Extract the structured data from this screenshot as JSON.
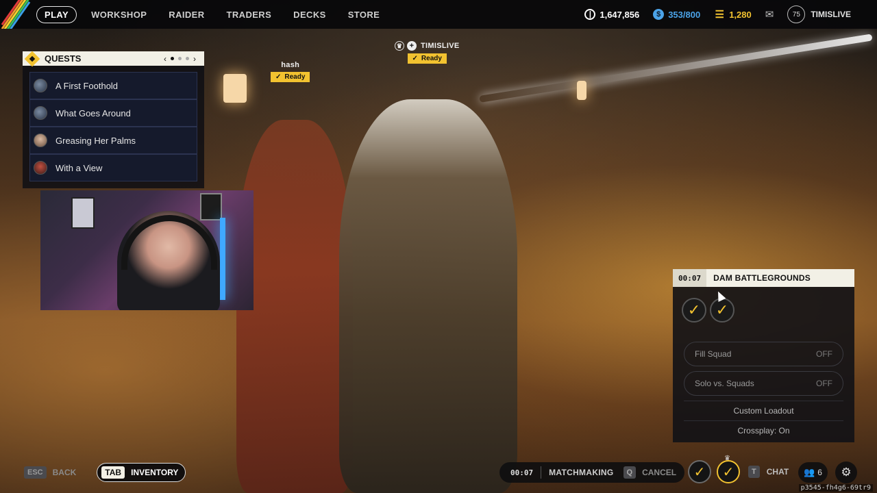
{
  "nav": {
    "items": [
      {
        "label": "PLAY",
        "active": true
      },
      {
        "label": "WORKSHOP",
        "active": false
      },
      {
        "label": "RAIDER",
        "active": false
      },
      {
        "label": "TRADERS",
        "active": false
      },
      {
        "label": "DECKS",
        "active": false
      },
      {
        "label": "STORE",
        "active": false
      }
    ]
  },
  "currencies": {
    "coins": "1,647,856",
    "raider_tokens": "353/800",
    "premium": "1,280"
  },
  "profile": {
    "level": "75",
    "username": "TIMISLIVE"
  },
  "quests": {
    "title": "QUESTS",
    "items": [
      {
        "label": "A First Foothold"
      },
      {
        "label": "What Goes Around"
      },
      {
        "label": "Greasing Her Palms"
      },
      {
        "label": "With a View"
      }
    ]
  },
  "party": {
    "players": [
      {
        "name": "hash",
        "status": "Ready"
      },
      {
        "name": "TIMISLIVE",
        "status": "Ready",
        "leader": true
      }
    ]
  },
  "matchmaking_panel": {
    "timer": "00:07",
    "map": "DAM BATTLEGROUNDS",
    "fill_squad_label": "Fill Squad",
    "fill_squad_value": "OFF",
    "solo_vs_squads_label": "Solo vs. Squads",
    "solo_vs_squads_value": "OFF",
    "custom_loadout": "Custom Loadout",
    "crossplay": "Crossplay: On"
  },
  "bottom_bar": {
    "esc_key": "ESC",
    "back_label": "BACK",
    "tab_key": "TAB",
    "inventory_label": "INVENTORY",
    "mm_timer": "00:07",
    "mm_label": "MATCHMAKING",
    "cancel_key": "Q",
    "cancel_label": "CANCEL",
    "chat_key": "T",
    "chat_label": "CHAT",
    "friends_count": "6"
  },
  "session_id": "p3545-fh4g6-69tr9",
  "colors": {
    "accent_yellow": "#f2c230",
    "raider_blue": "#4ba3e8"
  }
}
